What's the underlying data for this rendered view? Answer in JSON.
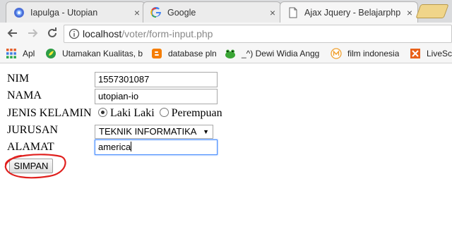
{
  "browser": {
    "tabs": [
      {
        "title": "Iapulga - Utopian",
        "icon": "utopian-icon",
        "active": false
      },
      {
        "title": "Google",
        "icon": "google-icon",
        "active": false
      },
      {
        "title": "Ajax Jquery - Belajarphp",
        "icon": "page-icon",
        "active": true
      }
    ],
    "close_glyph": "×",
    "url": {
      "host": "localhost",
      "path": "/voter/form-input.php"
    },
    "bookmarks": [
      {
        "label": "Apl",
        "icon": "apps-grid-icon"
      },
      {
        "label": "Utamakan Kualitas, b",
        "icon": "utamakan-icon"
      },
      {
        "label": "database pln",
        "icon": "blogger-icon"
      },
      {
        "label": "_^) Dewi Widia Angg",
        "icon": "frog-icon"
      },
      {
        "label": "film indonesia",
        "icon": "m-circle-icon"
      },
      {
        "label": "LiveSco",
        "icon": "livescore-icon"
      }
    ]
  },
  "form": {
    "nim_label": "NIM",
    "nim_value": "1557301087",
    "nama_label": "NAMA",
    "nama_value": "utopian-io",
    "gender_label": "JENIS KELAMIN",
    "gender_options": [
      "Laki Laki",
      "Perempuan"
    ],
    "gender_selected": "Laki Laki",
    "jurusan_label": "JURUSAN",
    "jurusan_value": "TEKNIK INFORMATIKA",
    "alamat_label": "ALAMAT",
    "alamat_value": "america",
    "submit_label": "SIMPAN"
  },
  "colors": {
    "annotation": "#e0201e",
    "focus": "#4d90fe"
  }
}
